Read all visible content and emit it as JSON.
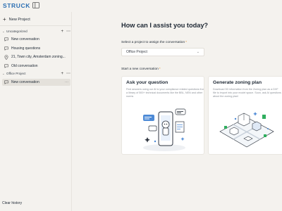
{
  "app": {
    "brand": "STRUCK"
  },
  "sidebar": {
    "new_project_label": "New Project",
    "groups": [
      {
        "label": "Uncategorized",
        "items": [
          {
            "label": "New conversation",
            "icon": "chat-icon"
          },
          {
            "label": "Housing questions",
            "icon": "chat-icon"
          },
          {
            "label": "21, Town city, Amsterdam zoning...",
            "icon": "location-pin-icon"
          },
          {
            "label": "Old conversation",
            "icon": "chat-icon"
          }
        ]
      },
      {
        "label": "Office Project",
        "items": [
          {
            "label": "New conversation",
            "icon": "chat-icon",
            "active": true
          }
        ]
      }
    ],
    "clear_history_label": "Clear history"
  },
  "main": {
    "headline": "How can I assist you today?",
    "project_select": {
      "label": "Select a project to assign the conversation",
      "required_mark": "*",
      "value": "Office Project"
    },
    "new_conversation": {
      "label": "Start a new conversation",
      "required_mark": "*",
      "cards": [
        {
          "title": "Ask your question",
          "description": "Find answers using our AI to your compliance related questions from a library of 500+ technical documents like the BBL, NEN and other norms"
        },
        {
          "title": "Generate zoning plan",
          "description": "Download 3D information from the Zoning plan as a DXF file to import into your model space. Soon, ask AI questions about the zoning plan!"
        }
      ]
    }
  },
  "colors": {
    "brand": "#2b6fb3",
    "background": "#f4f2ee",
    "accent_orange": "#e08a24",
    "illustration_blue": "#4d8ad6",
    "illustration_green": "#2fae5e"
  }
}
